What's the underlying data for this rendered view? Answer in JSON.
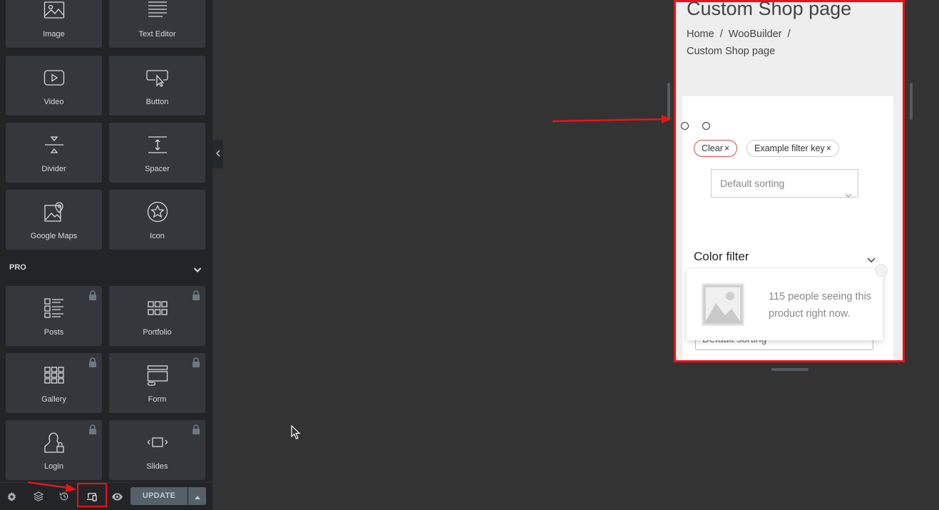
{
  "panel": {
    "widgets_top": [
      {
        "label": "Image",
        "icon": "image-icon"
      },
      {
        "label": "Text Editor",
        "icon": "text-editor-icon"
      },
      {
        "label": "Video",
        "icon": "video-icon"
      },
      {
        "label": "Button",
        "icon": "button-icon"
      },
      {
        "label": "Divider",
        "icon": "divider-icon"
      },
      {
        "label": "Spacer",
        "icon": "spacer-icon"
      },
      {
        "label": "Google Maps",
        "icon": "google-maps-icon"
      },
      {
        "label": "Icon",
        "icon": "star-icon"
      }
    ],
    "pro_section": {
      "label": "PRO",
      "expanded": true
    },
    "widgets_pro": [
      {
        "label": "Posts",
        "icon": "posts-icon",
        "locked": true
      },
      {
        "label": "Portfolio",
        "icon": "portfolio-icon",
        "locked": true
      },
      {
        "label": "Gallery",
        "icon": "gallery-icon",
        "locked": true
      },
      {
        "label": "Form",
        "icon": "form-icon",
        "locked": true
      },
      {
        "label": "Login",
        "icon": "login-icon",
        "locked": true
      },
      {
        "label": "Slides",
        "icon": "slides-icon",
        "locked": true
      }
    ]
  },
  "footer": {
    "icons": [
      "settings-icon",
      "navigator-icon",
      "history-icon",
      "responsive-mode-icon",
      "preview-eye-icon"
    ],
    "update_label": "UPDATE"
  },
  "preview": {
    "page_title": "Custom Shop page",
    "breadcrumb": [
      "Home",
      "WooBuilder",
      "Custom Shop page"
    ],
    "breadcrumb_separator": "/",
    "filter_chips": [
      {
        "label": "Clear",
        "close": "×"
      },
      {
        "label": "Example filter key",
        "close": "×"
      }
    ],
    "sorting_placeholder": "Default sorting",
    "color_filter_title": "Color filter",
    "popup_text": "115 people seeing this product right now.",
    "sorting_partial": "Default sorting"
  },
  "colors": {
    "highlight": "#e8141a",
    "panel_bg": "#222426",
    "widget_bg": "#34383c",
    "canvas_bg": "#333333",
    "update_button": "#556068"
  }
}
